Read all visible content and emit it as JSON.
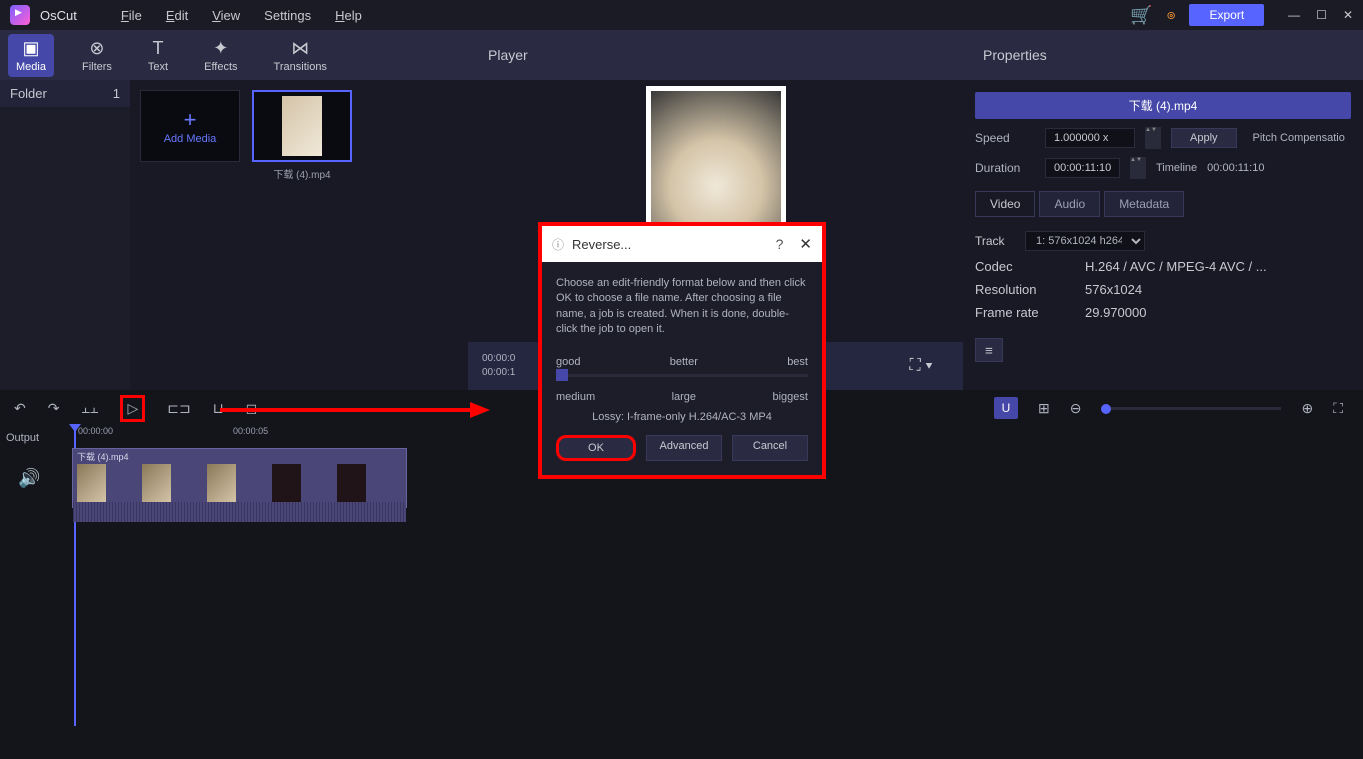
{
  "app": {
    "name": "OsCut",
    "menus": [
      "File",
      "Edit",
      "View",
      "Settings",
      "Help"
    ],
    "export_label": "Export"
  },
  "toolbar": {
    "items": [
      {
        "label": "Media",
        "icon": "▶"
      },
      {
        "label": "Filters",
        "icon": "⊗"
      },
      {
        "label": "Text",
        "icon": "T"
      },
      {
        "label": "Effects",
        "icon": "✦"
      },
      {
        "label": "Transitions",
        "icon": "⋈"
      }
    ]
  },
  "media": {
    "folder_label": "Folder",
    "folder_count": "1",
    "add_label": "Add Media",
    "files": [
      {
        "name": "下载 (4).mp4"
      }
    ]
  },
  "player": {
    "title": "Player",
    "time1": "00:00:0",
    "time2": "00:00:1"
  },
  "properties": {
    "title": "Properties",
    "filename": "下载 (4).mp4",
    "speed_label": "Speed",
    "speed_value": "1.000000 x",
    "apply_label": "Apply",
    "pitch_label": "Pitch Compensatio",
    "duration_label": "Duration",
    "duration_value": "00:00:11:10",
    "timeline_label": "Timeline",
    "timeline_value": "00:00:11:10",
    "tabs": [
      "Video",
      "Audio",
      "Metadata"
    ],
    "track_label": "Track",
    "track_value": "1: 576x1024 h264",
    "details": [
      {
        "label": "Codec",
        "value": "H.264 / AVC / MPEG-4 AVC / ..."
      },
      {
        "label": "Resolution",
        "value": "576x1024"
      },
      {
        "label": "Frame rate",
        "value": "29.970000"
      }
    ]
  },
  "timeline": {
    "output_label": "Output",
    "ruler": [
      "00:00:00",
      "00:00:05"
    ],
    "clip_name": "下载 (4).mp4"
  },
  "dialog": {
    "title": "Reverse...",
    "description": "Choose an edit-friendly format below and then click OK to choose a file name. After choosing a file name, a job is created. When it is done, double-click the job to open it.",
    "quality_labels": [
      "good",
      "better",
      "best"
    ],
    "size_labels": [
      "medium",
      "large",
      "biggest"
    ],
    "codec_info": "Lossy: I-frame-only H.264/AC-3 MP4",
    "buttons": {
      "ok": "OK",
      "advanced": "Advanced",
      "cancel": "Cancel"
    }
  }
}
